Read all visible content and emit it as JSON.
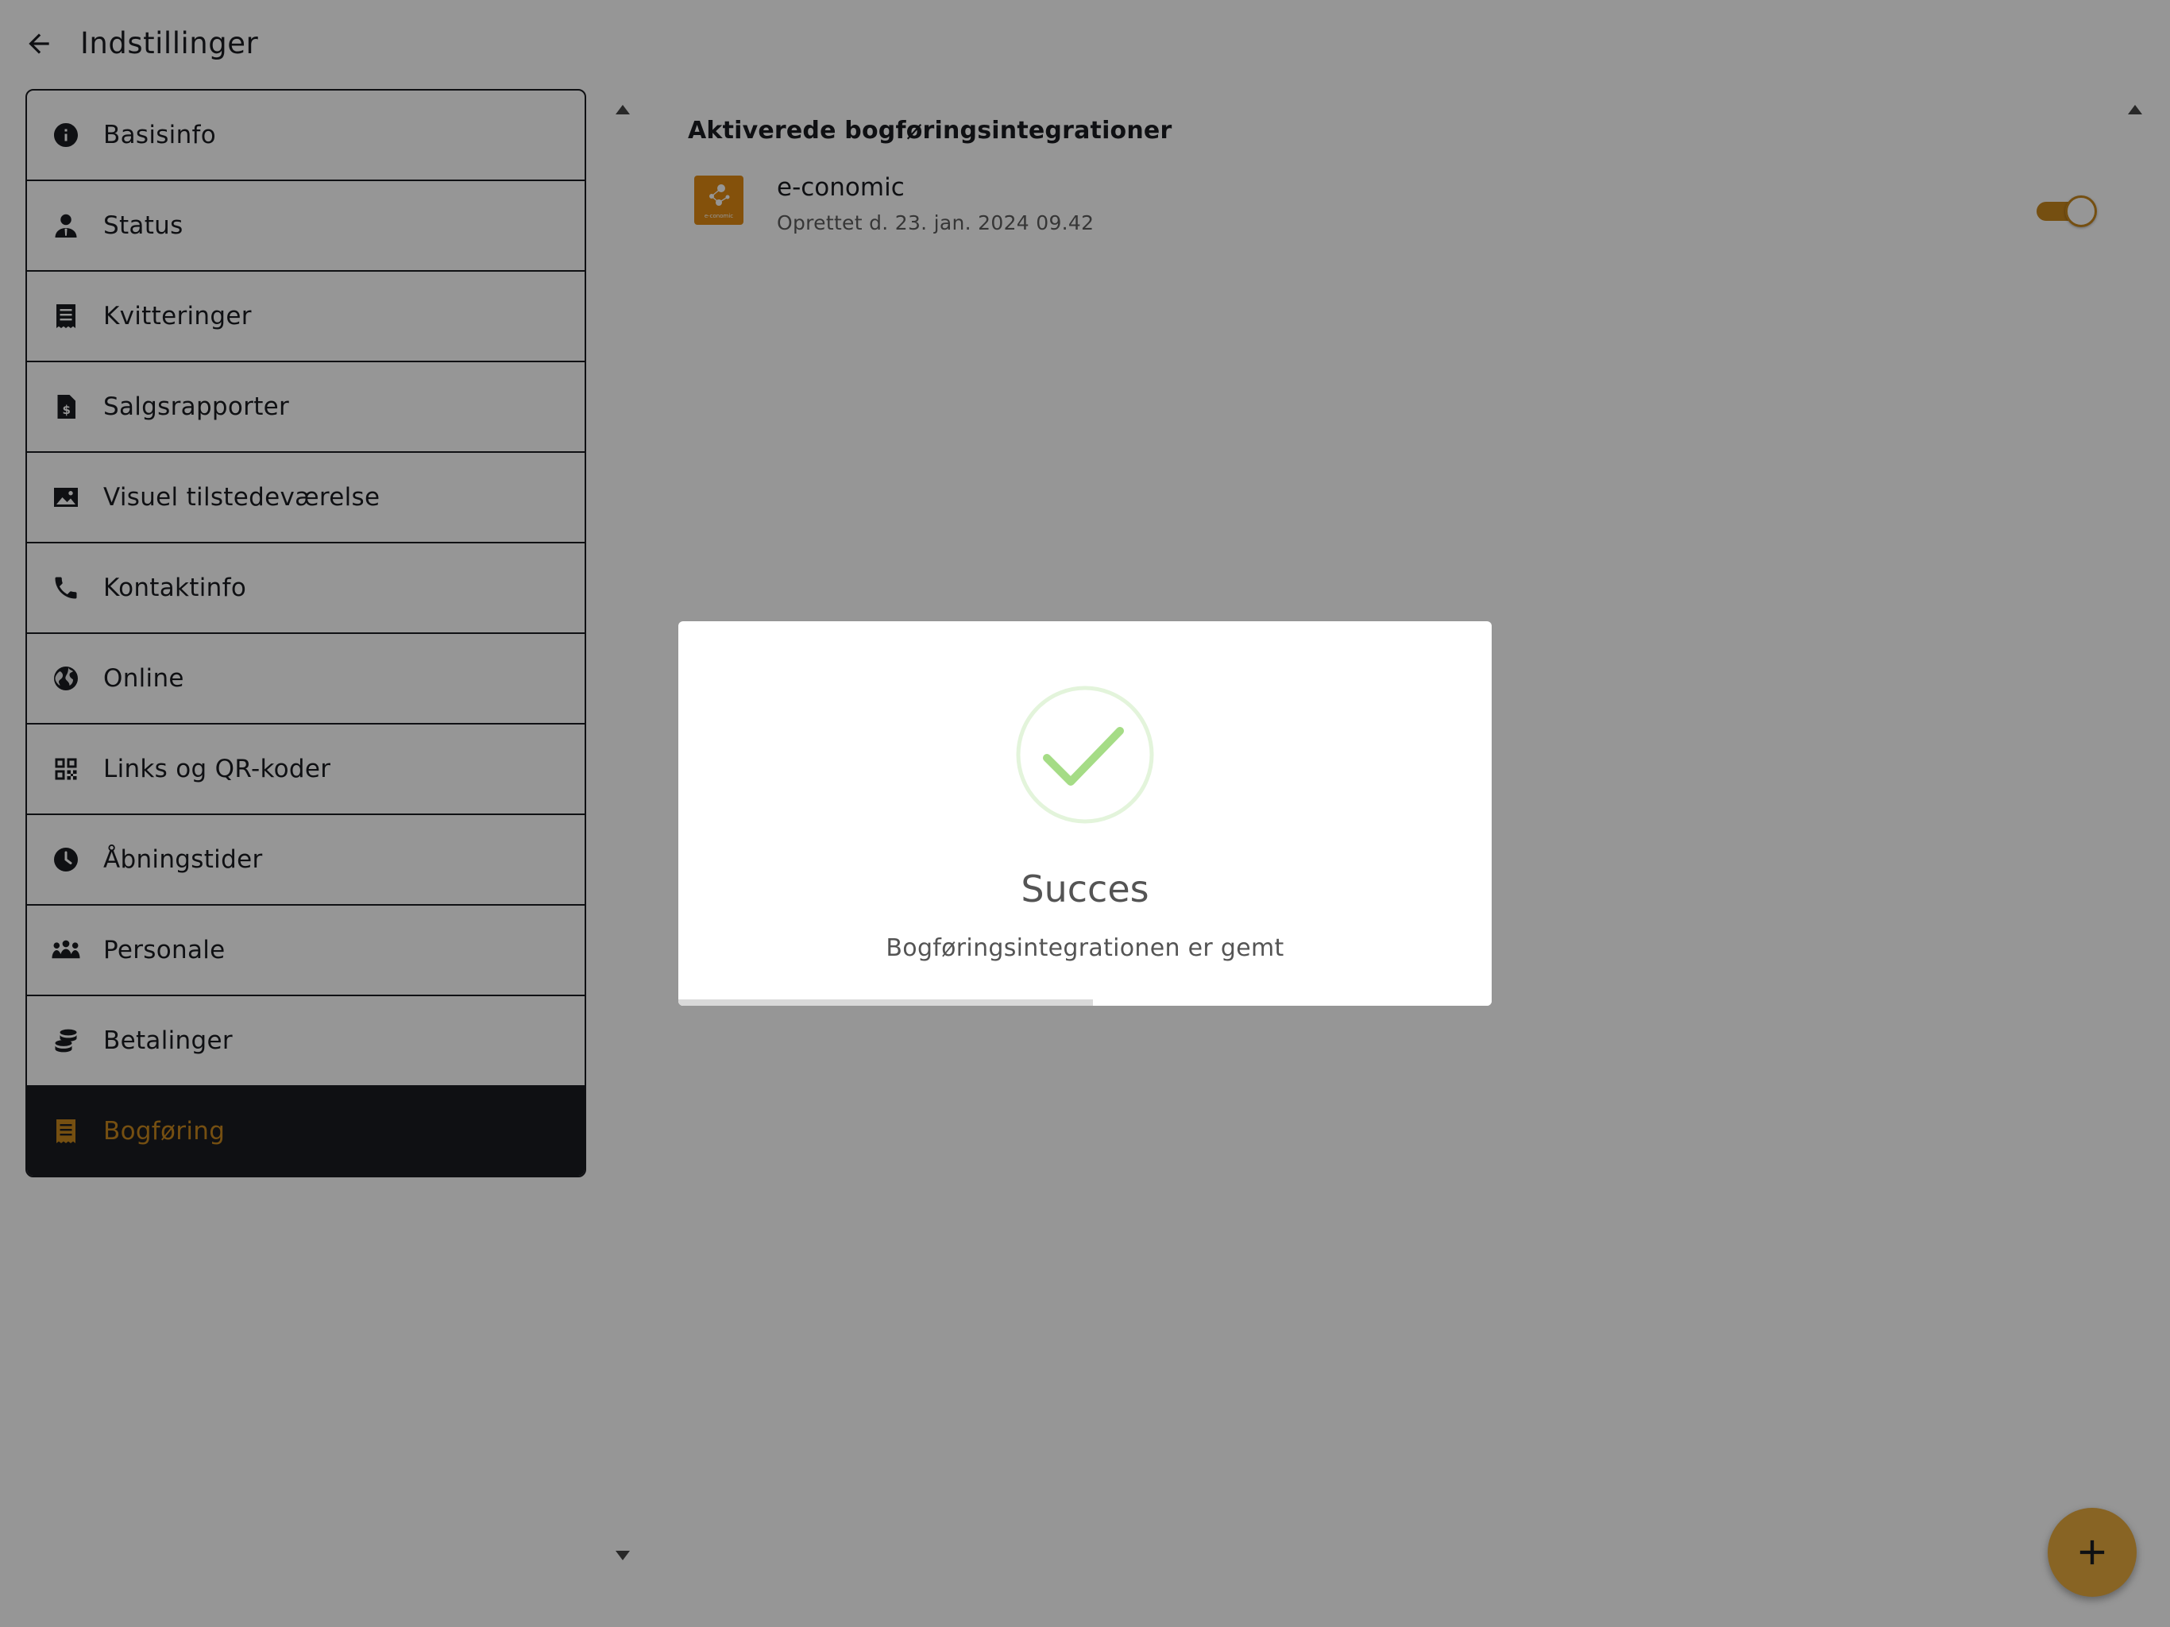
{
  "header": {
    "title": "Indstillinger",
    "back_icon": "arrow-left-icon"
  },
  "sidebar": {
    "items": [
      {
        "label": "Basisinfo",
        "icon": "info-icon",
        "active": false
      },
      {
        "label": "Status",
        "icon": "person-icon",
        "active": false
      },
      {
        "label": "Kvitteringer",
        "icon": "receipt-icon",
        "active": false
      },
      {
        "label": "Salgsrapporter",
        "icon": "report-dollar-icon",
        "active": false
      },
      {
        "label": "Visuel tilstedeværelse",
        "icon": "image-icon",
        "active": false
      },
      {
        "label": "Kontaktinfo",
        "icon": "phone-icon",
        "active": false
      },
      {
        "label": "Online",
        "icon": "globe-icon",
        "active": false
      },
      {
        "label": "Links og QR-koder",
        "icon": "qr-code-icon",
        "active": false
      },
      {
        "label": "Åbningstider",
        "icon": "clock-icon",
        "active": false
      },
      {
        "label": "Personale",
        "icon": "group-icon",
        "active": false
      },
      {
        "label": "Betalinger",
        "icon": "coins-icon",
        "active": false
      },
      {
        "label": "Bogføring",
        "icon": "receipt-icon",
        "active": true
      }
    ]
  },
  "main": {
    "section_heading": "Aktiverede bogføringsintegrationer",
    "integrations": [
      {
        "name": "e-conomic",
        "created": "Oprettet d. 23. jan. 2024 09.42",
        "enabled": true,
        "logo_text": "e-conomic"
      }
    ],
    "fab_icon": "plus-icon"
  },
  "modal": {
    "title": "Succes",
    "text": "Bogføringsintegrationen er gemt",
    "icon": "checkmark-icon",
    "progress": 0.51
  },
  "colors": {
    "accent": "#c7861e",
    "fab": "#e8aa3e",
    "dark": "#1b1c21",
    "success": "#a5dc86",
    "success_ring": "#e3f4db",
    "logo": "#e08a14"
  }
}
